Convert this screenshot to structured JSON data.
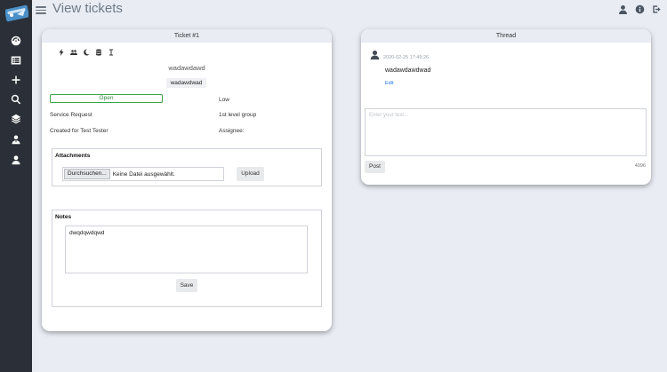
{
  "header": {
    "title": "View tickets"
  },
  "sidebar": {
    "items": [
      {
        "name": "dashboard-icon"
      },
      {
        "name": "list-icon"
      },
      {
        "name": "plus-icon"
      },
      {
        "name": "search-icon"
      },
      {
        "name": "layers-icon"
      },
      {
        "name": "users-icon"
      },
      {
        "name": "user-icon"
      }
    ]
  },
  "ticket": {
    "header": "Ticket #1",
    "title": "wadawdawd",
    "subtitle": "wadawdwad",
    "status": "Open",
    "priority": "Low",
    "type": "Service Request",
    "group": "1st level group",
    "created_for": "Created for Test Tester",
    "assignee": "Assignee:",
    "attachments": {
      "title": "Attachments",
      "browse_label": "Durchsuchen...",
      "no_file": "Keine Datei ausgewählt.",
      "upload_label": "Upload"
    },
    "notes": {
      "title": "Notes",
      "value": "dwqdqwdqwd",
      "save_label": "Save"
    }
  },
  "thread": {
    "header": "Thread",
    "message": {
      "timestamp": "2020-02-25 17:49:26",
      "body": "wadawdawdwad",
      "edit_label": "Edit"
    },
    "reply": {
      "placeholder": "Enter your text...",
      "post_label": "Post",
      "char_count": "4096"
    }
  },
  "colors": {
    "sidebar": "#2b3038",
    "status_open": "#3aa64a",
    "link": "#1a73e8"
  }
}
